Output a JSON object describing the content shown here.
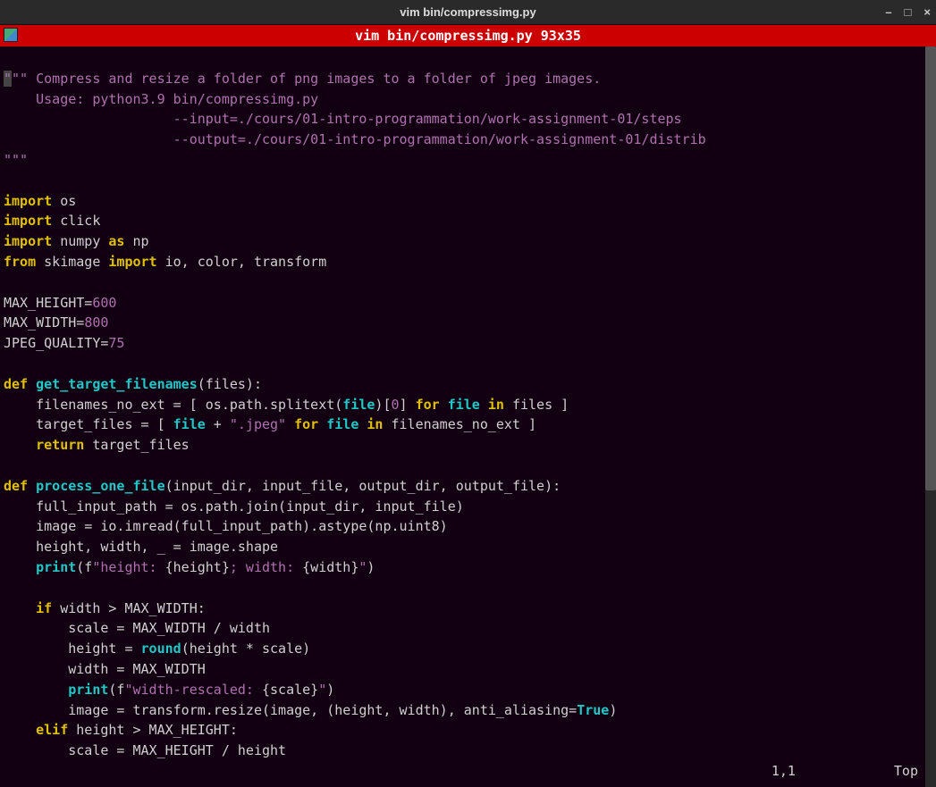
{
  "window": {
    "title": "vim bin/compressimg.py",
    "controls": {
      "min": "–",
      "max": "□",
      "close": "×"
    }
  },
  "tab": {
    "label": "vim bin/compressimg.py 93x35"
  },
  "status": {
    "pos": "1,1",
    "scroll": "Top"
  },
  "code": {
    "l01a": "\"",
    "l01b": "\"\" Compress and resize a folder of png images to a folder of jpeg images.",
    "l02": "    Usage: python3.9 bin/compressimg.py",
    "l03": "                     --input=./cours/01-intro-programmation/work-assignment-01/steps",
    "l04": "                     --output=./cours/01-intro-programmation/work-assignment-01/distrib",
    "l05": "\"\"\"",
    "l06": "",
    "l07_kw": "import",
    "l07_id": " os",
    "l08_kw": "import",
    "l08_id": " click",
    "l09_kw1": "import",
    "l09_id1": " numpy ",
    "l09_kw2": "as",
    "l09_id2": " np",
    "l10_kw1": "from",
    "l10_id1": " skimage ",
    "l10_kw2": "import",
    "l10_id2": " io, color, transform",
    "l11": "",
    "l12a": "MAX_HEIGHT=",
    "l12b": "600",
    "l13a": "MAX_WIDTH=",
    "l13b": "800",
    "l14a": "JPEG_QUALITY=",
    "l14b": "75",
    "l15": "",
    "l16_def": "def ",
    "l16_fn": "get_target_filenames",
    "l16_rest": "(files):",
    "l17a": "    filenames_no_ext = [ os.path.splitext(",
    "l17b": "file",
    "l17c": ")[",
    "l17d": "0",
    "l17e": "] ",
    "l17f": "for ",
    "l17g": "file ",
    "l17h": "in",
    "l17i": " files ]",
    "l18a": "    target_files = [ ",
    "l18b": "file",
    "l18c": " + ",
    "l18d": "\".jpeg\"",
    "l18e": " ",
    "l18f": "for ",
    "l18g": "file ",
    "l18h": "in",
    "l18i": " filenames_no_ext ]",
    "l19a": "    ",
    "l19b": "return",
    "l19c": " target_files",
    "l20": "",
    "l21_def": "def ",
    "l21_fn": "process_one_file",
    "l21_rest": "(input_dir, input_file, output_dir, output_file):",
    "l22": "    full_input_path = os.path.join(input_dir, input_file)",
    "l23": "    image = io.imread(full_input_path).astype(np.uint8)",
    "l24": "    height, width, _ = image.shape",
    "l25a": "    ",
    "l25b": "print",
    "l25c": "(f",
    "l25d": "\"height: ",
    "l25e": "{height}",
    "l25f": "; width: ",
    "l25g": "{width}",
    "l25h": "\"",
    "l25i": ")",
    "l26": "",
    "l27a": "    ",
    "l27b": "if",
    "l27c": " width > MAX_WIDTH:",
    "l28": "        scale = MAX_WIDTH / width",
    "l29a": "        height = ",
    "l29b": "round",
    "l29c": "(height * scale)",
    "l30": "        width = MAX_WIDTH",
    "l31a": "        ",
    "l31b": "print",
    "l31c": "(f",
    "l31d": "\"width-rescaled: ",
    "l31e": "{scale}",
    "l31f": "\"",
    "l31g": ")",
    "l32a": "        image = transform.resize(image, (height, width), anti_aliasing=",
    "l32b": "True",
    "l32c": ")",
    "l33a": "    ",
    "l33b": "elif",
    "l33c": " height > MAX_HEIGHT:",
    "l34": "        scale = MAX_HEIGHT / height"
  }
}
